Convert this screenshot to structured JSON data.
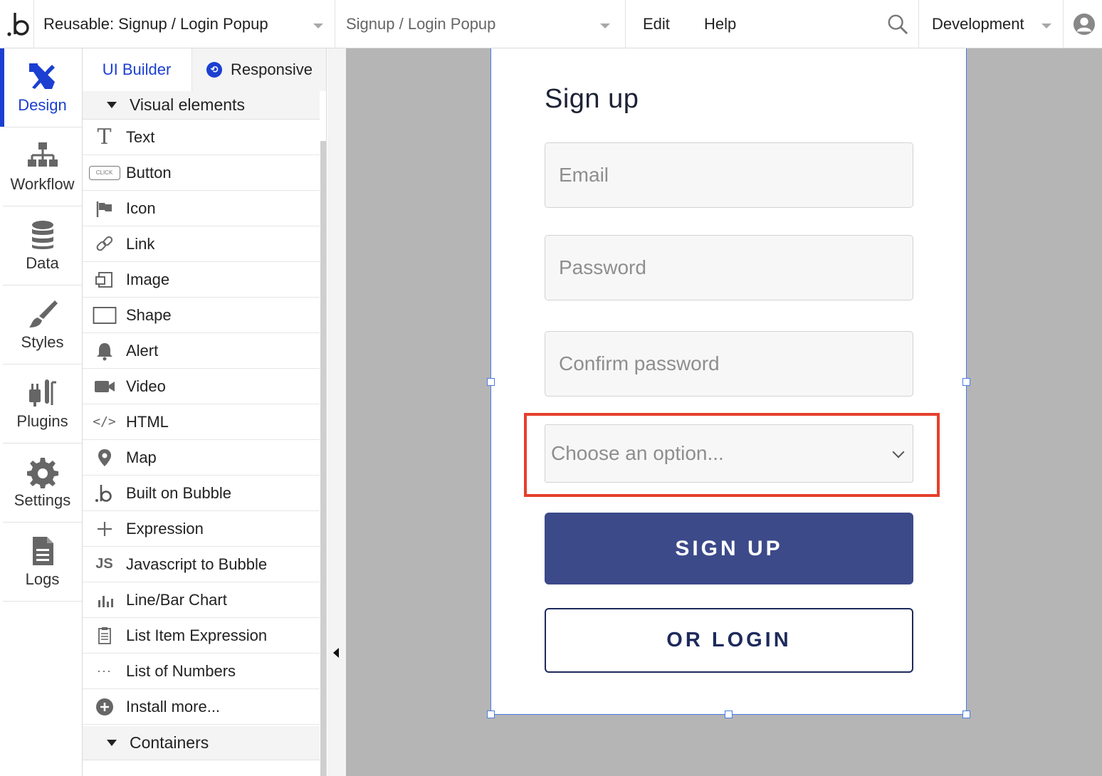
{
  "topbar": {
    "page_selector": "Reusable: Signup / Login Popup",
    "element_selector": "Signup / Login Popup",
    "menu": [
      "Edit",
      "Help"
    ],
    "environment": "Development",
    "icons": {
      "logo": "bubble-logo-icon",
      "search": "search-icon",
      "user": "user-avatar-icon"
    }
  },
  "rail": {
    "items": [
      {
        "label": "Design",
        "icon": "design-tools-icon",
        "active": true
      },
      {
        "label": "Workflow",
        "icon": "workflow-icon"
      },
      {
        "label": "Data",
        "icon": "database-icon"
      },
      {
        "label": "Styles",
        "icon": "paintbrush-icon"
      },
      {
        "label": "Plugins",
        "icon": "plug-icon"
      },
      {
        "label": "Settings",
        "icon": "gear-icon"
      },
      {
        "label": "Logs",
        "icon": "document-icon"
      }
    ],
    "accent": "#1b3fd1"
  },
  "palette": {
    "tabs": [
      "UI Builder",
      "Responsive"
    ],
    "sections": [
      "Visual elements",
      "Containers"
    ],
    "items": [
      {
        "label": "Text",
        "icon": "text-t-icon"
      },
      {
        "label": "Button",
        "icon": "button-click-icon"
      },
      {
        "label": "Icon",
        "icon": "flag-icon"
      },
      {
        "label": "Link",
        "icon": "link-icon"
      },
      {
        "label": "Image",
        "icon": "image-icon"
      },
      {
        "label": "Shape",
        "icon": "rectangle-icon"
      },
      {
        "label": "Alert",
        "icon": "bell-icon"
      },
      {
        "label": "Video",
        "icon": "video-camera-icon"
      },
      {
        "label": "HTML",
        "icon": "code-icon"
      },
      {
        "label": "Map",
        "icon": "map-pin-icon"
      },
      {
        "label": "Built on Bubble",
        "icon": "bubble-b-icon"
      },
      {
        "label": "Expression",
        "icon": "plus-icon"
      },
      {
        "label": "Javascript to Bubble",
        "icon": "js-icon"
      },
      {
        "label": "Line/Bar Chart",
        "icon": "bar-chart-icon"
      },
      {
        "label": "List Item Expression",
        "icon": "clipboard-list-icon"
      },
      {
        "label": "List of Numbers",
        "icon": "ellipsis-icon"
      },
      {
        "label": "Install more...",
        "icon": "plus-circle-icon"
      }
    ]
  },
  "popup": {
    "title": "Sign up",
    "email_placeholder": "Email",
    "password_placeholder": "Password",
    "confirm_placeholder": "Confirm password",
    "dropdown_placeholder": "Choose an option...",
    "signup_label": "SIGN UP",
    "login_label": "OR LOGIN",
    "colors": {
      "primary": "#3c4a8a",
      "outline": "#1d2a5c",
      "highlight": "#e5402c",
      "selection": "#4a7be8"
    }
  }
}
